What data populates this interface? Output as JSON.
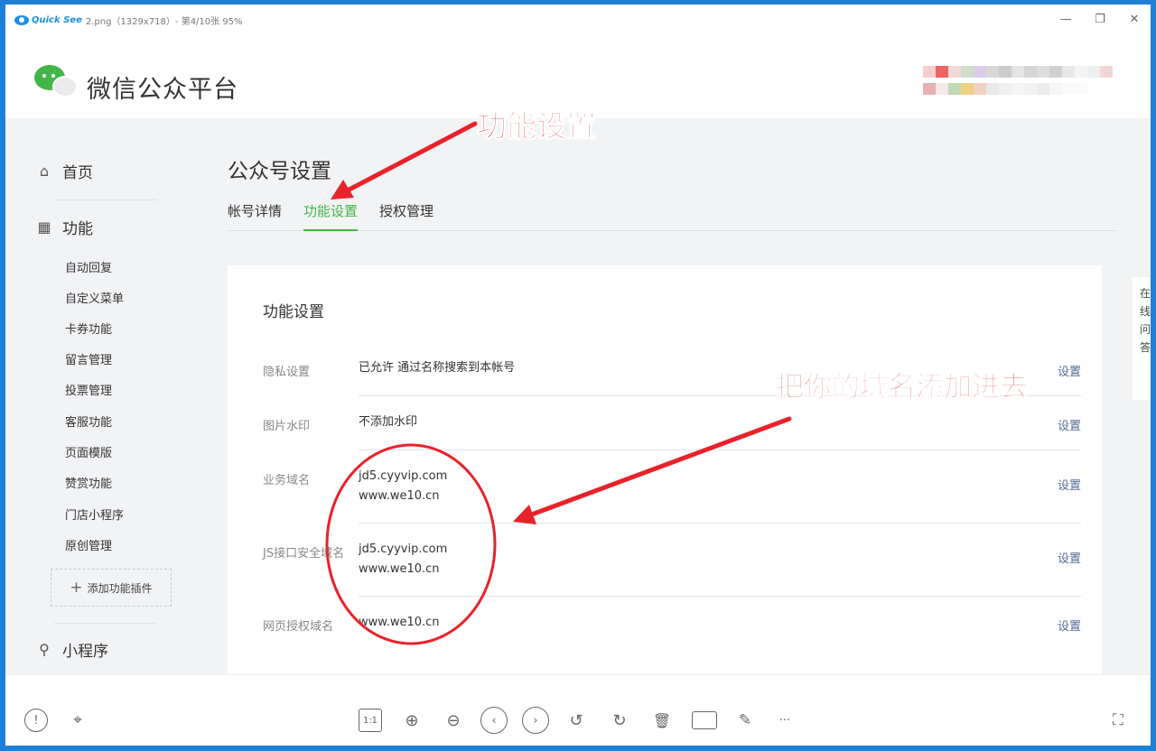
{
  "viewer": {
    "app_name": "Quick See",
    "window_title": "2.png（1329x718）- 第4/10张 95%",
    "controls": [
      "minimize-icon",
      "restore-icon",
      "close-icon"
    ]
  },
  "screenshot": {
    "brand": "微信公众平台",
    "sidebar": {
      "home": "首页",
      "features": "功能",
      "sub_items": [
        "自动回复",
        "自定义菜单",
        "卡券功能",
        "留言管理",
        "投票管理",
        "客服功能",
        "页面模版",
        "赞赏功能",
        "门店小程序",
        "原创管理"
      ],
      "add_plugin": "添加功能插件",
      "mini_program": "小程序"
    },
    "page_title": "公众号设置",
    "tabs": [
      "帐号详情",
      "功能设置",
      "授权管理"
    ],
    "active_tab": 1,
    "panel_title": "功能设置",
    "rows": [
      {
        "label": "隐私设置",
        "value": "已允许 通过名称搜索到本帐号",
        "action": "设置"
      },
      {
        "label": "图片水印",
        "value": "不添加水印",
        "action": "设置"
      },
      {
        "label": "业务域名",
        "value1": "jd5.cyyvip.com",
        "value2": "www.we10.cn",
        "action": "设置"
      },
      {
        "label": "JS接口安全域名",
        "value1": "jd5.cyyvip.com",
        "value2": "www.we10.cn",
        "action": "设置"
      },
      {
        "label": "网页授权域名",
        "value": "www.we10.cn",
        "action": "设置"
      }
    ],
    "side_tip": "在\n线\n问\n答"
  },
  "annotations": {
    "top": "功能设置",
    "middle": "把你的域名添加进去",
    "color": "#E8222A"
  },
  "toolbar": {
    "actual_size": "1:1",
    "more": "···"
  },
  "colors": {
    "accent_green": "#44B549",
    "link": "#576B95",
    "desktop": "#1E7FD6"
  }
}
